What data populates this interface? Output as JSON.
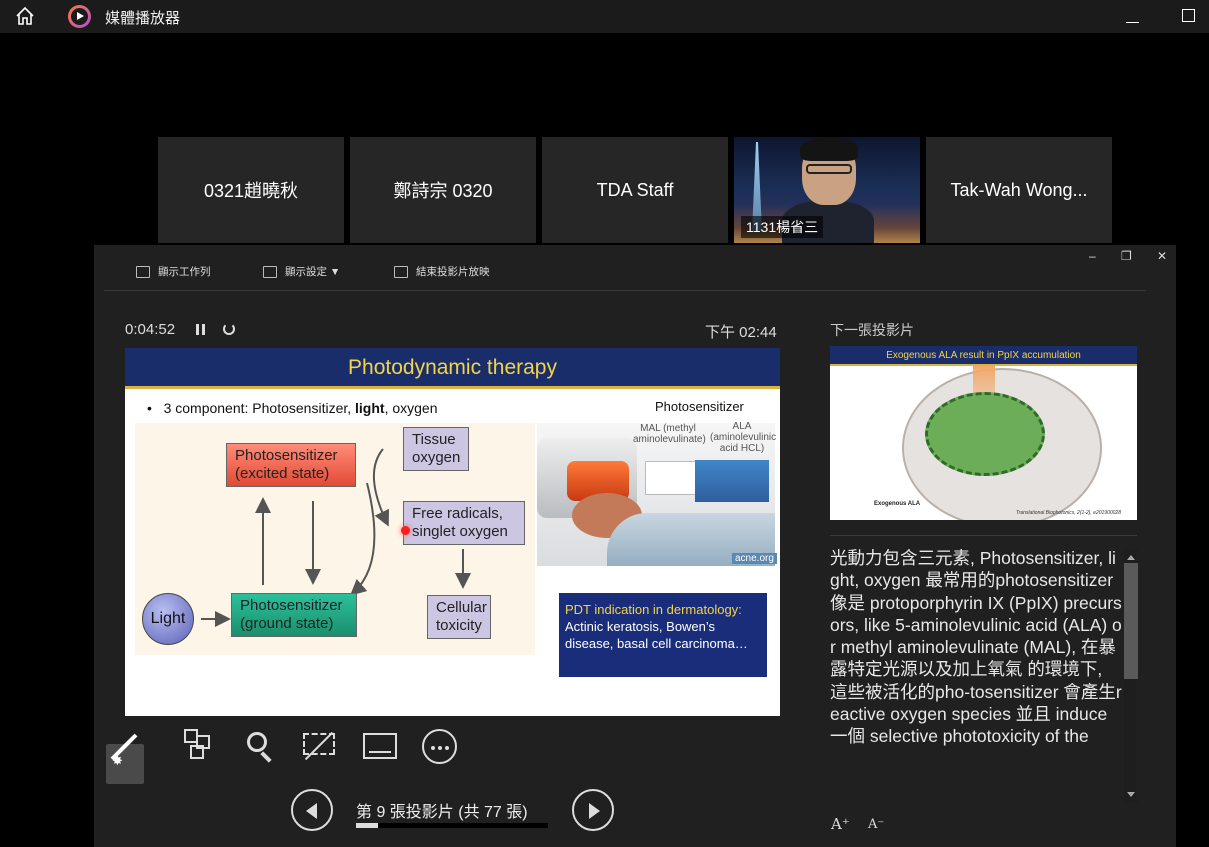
{
  "window": {
    "title": "媒體播放器"
  },
  "participants": [
    {
      "name": "0321趙曉秋",
      "video": false
    },
    {
      "name": "鄭詩宗 0320",
      "video": false
    },
    {
      "name": "TDA Staff",
      "video": false
    },
    {
      "name": "1131楊省三",
      "video": true
    },
    {
      "name": "Tak-Wah Wong...",
      "video": false
    }
  ],
  "toolbar": {
    "taskbar_label": "顯示工作列",
    "display_label": "顯示設定 ▼",
    "end_label": "結束投影片放映"
  },
  "presenter": {
    "timer": "0:04:52",
    "clock": "下午 02:44",
    "slide_counter": "第 9 張投影片 (共 77 張)",
    "current_slide": 9,
    "total_slides": 77,
    "next_slide_label": "下一張投影片"
  },
  "slide": {
    "title": "Photodynamic therapy",
    "bullet_prefix": "3 component:  Photosensitizer, ",
    "bullet_bold": "light",
    "bullet_suffix": ", oxygen",
    "photosensitizer_heading": "Photosensitizer",
    "mal_label": "MAL (methyl aminolevulinate)",
    "ala_label": "ALA (aminolevulinic acid HCL)",
    "photo_credit": "acne.org",
    "boxes": {
      "excited": "Photosensitizer (excited state)",
      "tissue_oxygen": "Tissue oxygen",
      "free_radicals": "Free radicals, singlet oxygen",
      "ground": "Photosensitizer (ground state)",
      "toxicity": "Cellular toxicity",
      "light": "Light"
    },
    "pdt_heading": "PDT indication in dermatology:",
    "pdt_body": "Actinic keratosis, Bowen’s disease, basal cell carcinoma…"
  },
  "next_slide": {
    "title": "Exogenous ALA result in PpIX accumulation",
    "caption": "Exogenous ALA",
    "reference": "Translational Biophotonics, 2(1-2), e201900028"
  },
  "notes": "光動力包含三元素, Photosensitizer, light, oxygen 最常用的photosensitizer 像是 protoporphyrin IX (PpIX) precursors, like 5-aminolevulinic acid (ALA) or methyl aminolevulinate (MAL), 在暴露特定光源以及加上氧氣 的環境下, 這些被活化的pho-tosensitizer 會產生reactive oxygen species 並且 induce一個 selective phototoxicity of the"
}
